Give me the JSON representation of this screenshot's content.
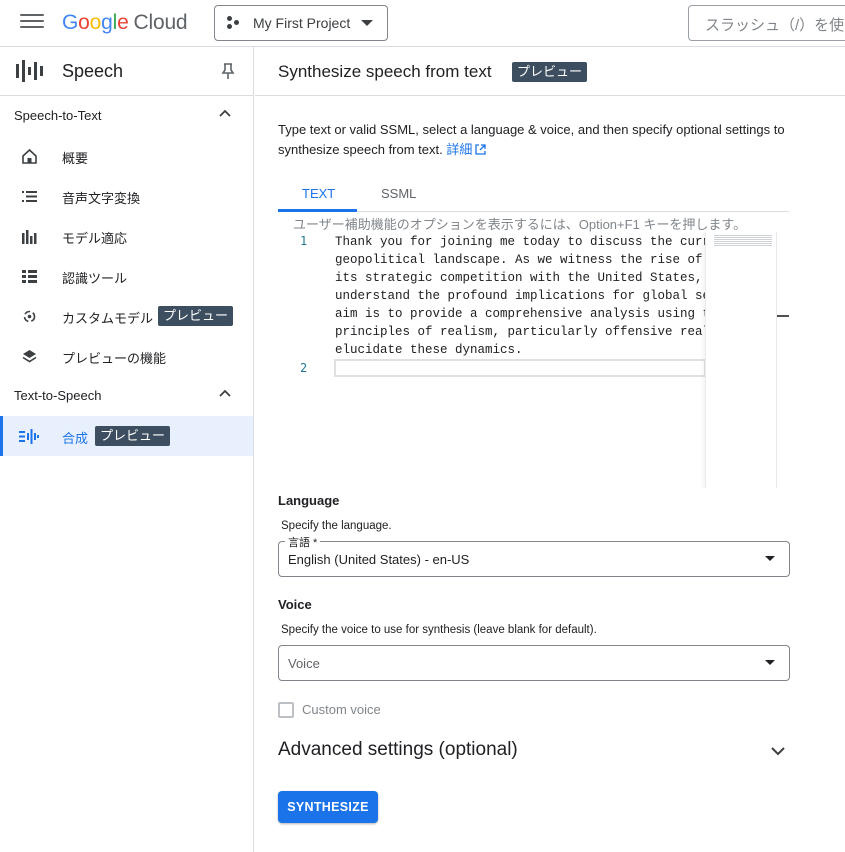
{
  "topbar": {
    "logo_letters": [
      "G",
      "o",
      "o",
      "g",
      "l",
      "e"
    ],
    "logo_suffix": "Cloud",
    "project_name": "My First Project",
    "search_placeholder": "スラッシュ（/）を使"
  },
  "sidebar": {
    "title": "Speech",
    "sections": [
      {
        "label": "Speech-to-Text",
        "items": [
          {
            "label": "概要",
            "icon": "home-icon"
          },
          {
            "label": "音声文字変換",
            "icon": "list-icon"
          },
          {
            "label": "モデル適応",
            "icon": "bars-icon"
          },
          {
            "label": "認識ツール",
            "icon": "grid-list-icon"
          },
          {
            "label": "カスタムモデル",
            "icon": "custom-model-icon",
            "badge": "プレビュー"
          },
          {
            "label": "プレビューの機能",
            "icon": "layers-icon"
          }
        ]
      },
      {
        "label": "Text-to-Speech",
        "items": [
          {
            "label": "合成",
            "icon": "synthesize-icon",
            "badge": "プレビュー",
            "active": true
          }
        ]
      }
    ]
  },
  "main": {
    "title": "Synthesize speech from text",
    "title_badge": "プレビュー",
    "description": "Type text or valid SSML, select a language & voice, and then specify optional settings to synthesize speech from text.",
    "description_link": "詳細",
    "tabs": [
      "TEXT",
      "SSML"
    ],
    "editor_hint": "ユーザー補助機能のオプションを表示するには、Option+F1 キーを押します。",
    "line_numbers": [
      "1",
      "2"
    ],
    "code_lines": [
      "Thank you for joining me today to discuss the curren",
      "geopolitical landscape. As we witness the rise of Ch",
      "its strategic competition with the United States, we",
      "understand the profound implications for global secu",
      "aim is to provide a comprehensive analysis using the",
      "principles of realism, particularly offensive realis",
      "elucidate these dynamics."
    ],
    "language": {
      "heading": "Language",
      "help": "Specify the language.",
      "field_label": "言語 *",
      "value": "English (United States) - en-US"
    },
    "voice": {
      "heading": "Voice",
      "help": "Specify the voice to use for synthesis (leave blank for default).",
      "placeholder": "Voice"
    },
    "custom_voice_label": "Custom voice",
    "advanced_label": "Advanced settings (optional)",
    "synthesize_label": "SYNTHESIZE"
  },
  "colors": {
    "accent": "#1a73e8",
    "badge_bg": "#3c4e5f",
    "active_bg": "#e8f0fe"
  }
}
